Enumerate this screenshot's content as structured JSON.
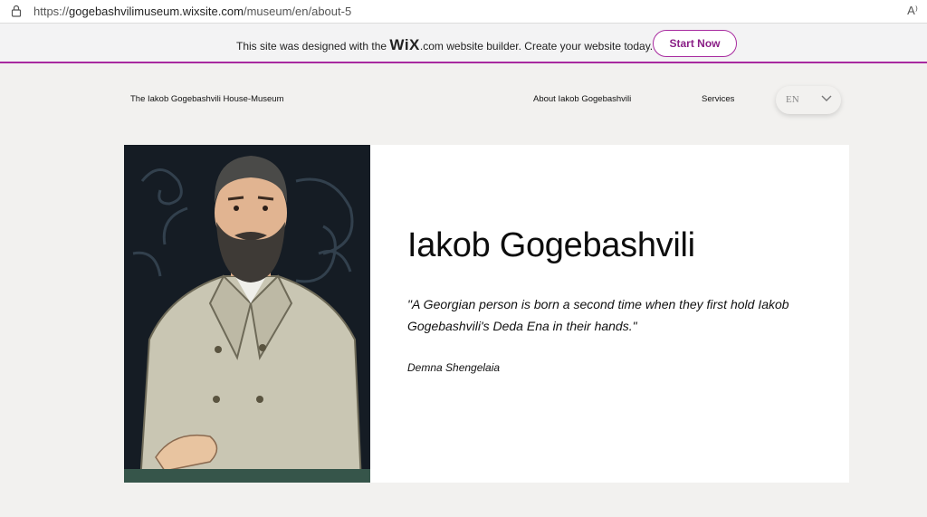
{
  "browser": {
    "url_prefix": "https://",
    "url_host": "gogebashvilimuseum.wixsite.com",
    "url_path": "/museum/en/about-5",
    "read_aloud": "A⁾"
  },
  "wix_banner": {
    "text_before": "This site was designed with the ",
    "logo": "WiX",
    "dotcom": ".com",
    "text_after": " website builder. Create your website today.",
    "button": "Start Now",
    "accent": "#a82a9f"
  },
  "header": {
    "site_title": "The Iakob Gogebashvili House-Museum",
    "nav": {
      "about": "About Iakob Gogebashvili",
      "services": "Services"
    },
    "language": "EN"
  },
  "main": {
    "heading": "Iakob Gogebashvili",
    "quote": "\"A Georgian person is born a second time when they first hold Iakob Gogebashvili's Deda Ena in their hands.\"",
    "author": "Demna Shengelaia"
  }
}
